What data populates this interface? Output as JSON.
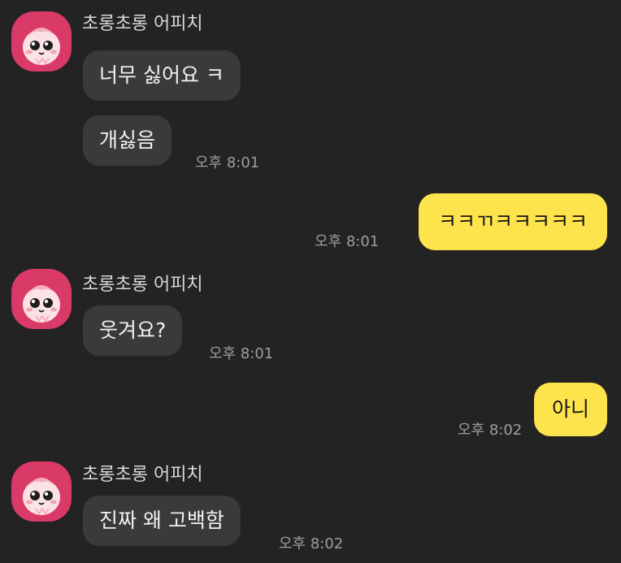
{
  "colors": {
    "background": "#232323",
    "incoming_bubble": "#3a3a3a",
    "outgoing_bubble": "#fde34c",
    "avatar": "#d93a67"
  },
  "icons": {
    "avatar": "apeach-character-icon"
  },
  "messages": [
    {
      "direction": "incoming",
      "sender": "초롱초롱 어피치",
      "bubbles": [
        "너무 싫어요 ㅋ",
        "개싫음"
      ],
      "time": "오후 8:01"
    },
    {
      "direction": "outgoing",
      "bubbles": [
        "ㅋㅋㄲㅋㅋㅋㅋㅋ"
      ],
      "time": "오후 8:01"
    },
    {
      "direction": "incoming",
      "sender": "초롱초롱 어피치",
      "bubbles": [
        "웃겨요?"
      ],
      "time": "오후 8:01"
    },
    {
      "direction": "outgoing",
      "bubbles": [
        "아니"
      ],
      "time": "오후 8:02"
    },
    {
      "direction": "incoming",
      "sender": "초롱초롱 어피치",
      "bubbles": [
        "진짜 왜 고백함"
      ],
      "time": "오후 8:02"
    }
  ]
}
